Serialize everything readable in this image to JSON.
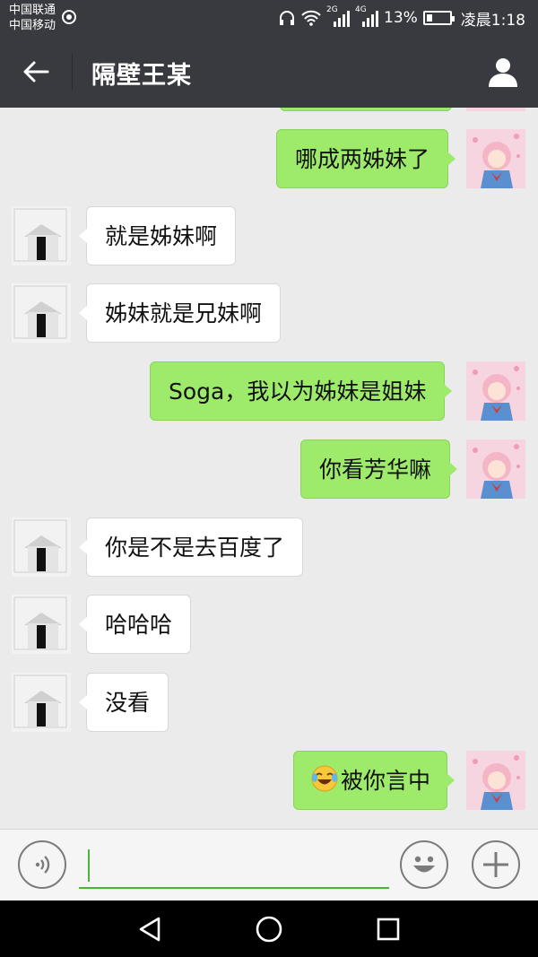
{
  "status_bar": {
    "carrier_1": "中国联通",
    "carrier_2": "中国移动",
    "network_1": "2G",
    "network_2": "4G",
    "battery": "13%",
    "time": "凌晨1:18"
  },
  "header": {
    "title": "隔壁王某"
  },
  "messages": [
    {
      "from": "me",
      "text": "哪成两姊妹了"
    },
    {
      "from": "other",
      "text": "就是姊妹啊"
    },
    {
      "from": "other",
      "text": "姊妹就是兄妹啊"
    },
    {
      "from": "me",
      "text": "Soga，我以为姊妹是姐妹"
    },
    {
      "from": "me",
      "text": "你看芳华嘛"
    },
    {
      "from": "other",
      "text": "你是不是去百度了"
    },
    {
      "from": "other",
      "text": "哈哈哈"
    },
    {
      "from": "other",
      "text": "没看"
    },
    {
      "from": "me",
      "text": "被你言中",
      "emoji": "laughing-crying-emoji"
    }
  ],
  "input": {
    "value": ""
  },
  "icons": {
    "back": "back-arrow-icon",
    "profile": "person-icon",
    "voice": "voice-icon",
    "emoji": "smiley-icon",
    "more": "plus-icon"
  },
  "colors": {
    "header_bg": "#393a3f",
    "chat_bg": "#ebebeb",
    "my_bubble": "#9eea6a",
    "their_bubble": "#ffffff",
    "input_accent": "#4ab534"
  }
}
